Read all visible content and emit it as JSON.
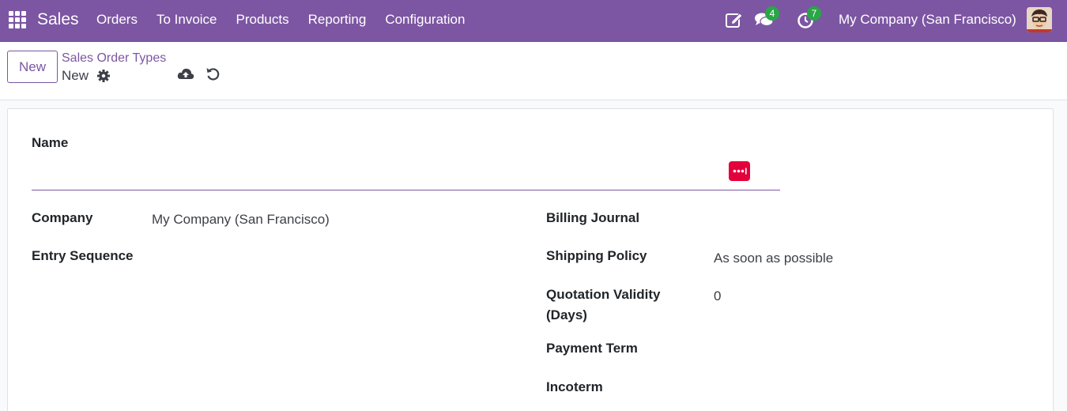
{
  "navbar": {
    "app_name": "Sales",
    "menu": [
      "Orders",
      "To Invoice",
      "Products",
      "Reporting",
      "Configuration"
    ],
    "messages_count": "4",
    "activities_count": "7",
    "company": "My Company (San Francisco)",
    "color": "#7c56a2"
  },
  "control_panel": {
    "new_label": "New",
    "breadcrumb_parent": "Sales Order Types",
    "breadcrumb_current": "New"
  },
  "form": {
    "name_label": "Name",
    "name_value": "",
    "company_label": "Company",
    "company_value": "My Company (San Francisco)",
    "entry_sequence_label": "Entry Sequence",
    "entry_sequence_value": "",
    "billing_journal_label": "Billing Journal",
    "billing_journal_value": "",
    "shipping_policy_label": "Shipping Policy",
    "shipping_policy_value": "As soon as possible",
    "quotation_validity_label_1": "Quotation Validity",
    "quotation_validity_label_2": "(Days)",
    "quotation_validity_value": "0",
    "payment_term_label": "Payment Term",
    "payment_term_value": "",
    "incoterm_label": "Incoterm",
    "incoterm_value": ""
  },
  "icons": {
    "apps": "apps-grid-icon",
    "edit": "edit-note-icon",
    "messages": "chat-bubbles-icon",
    "activities": "clock-icon",
    "gear": "gear-icon",
    "save": "cloud-upload-icon",
    "discard": "undo-icon",
    "password_manager": "password-manager-icon"
  }
}
